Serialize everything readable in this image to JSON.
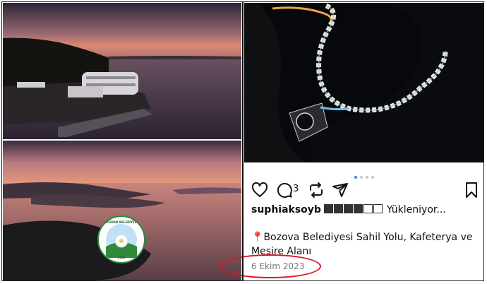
{
  "post": {
    "username": "suphiaksoyb",
    "status_text": "Yükleniyor...",
    "comment_count": "3",
    "location_pin": "📍",
    "location": "Bozova Belediyesi Sahil Yolu, Kafeterya ve Mesire Alanı",
    "date": "6 Ekim 2023"
  },
  "logo": {
    "arc_text": "BOZOVA BELEDİYESİ",
    "year": "1926"
  },
  "carousel": {
    "count": 4,
    "active_index": 0
  },
  "colors": {
    "highlight": "#e0141c",
    "active_dot": "#3b82f6"
  },
  "icons": [
    "heart-icon",
    "comment-icon",
    "repost-icon",
    "share-icon",
    "bookmark-icon"
  ]
}
